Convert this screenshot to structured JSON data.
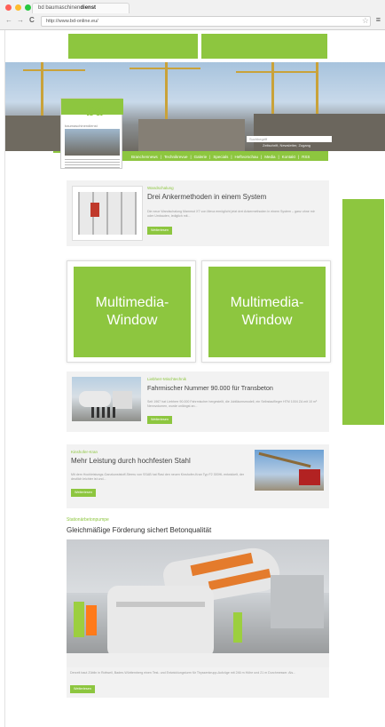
{
  "browser": {
    "tab_title_plain": "bd baumaschinen",
    "tab_title_bold": "dienst",
    "back": "←",
    "forward": "→",
    "reload": "C",
    "url": "http://www.bd-online.eu/",
    "bookmark_icon": "star-icon",
    "menu_icon": "hamburger-icon",
    "dot_colors": [
      "#ff5f57",
      "#febc2e",
      "#28c840"
    ]
  },
  "brand": {
    "accent": "#8dc63f"
  },
  "header": {
    "logo": "bd",
    "logo_sub": "baumaschinendienst",
    "search_placeholder": "Suchbegriff",
    "search_sub": "Zeitschrift, Newsletter, Zugang",
    "nav": [
      "Branchennews",
      "|",
      "Technikrevue",
      "|",
      "Galerie",
      "|",
      "Specials",
      "|",
      "Heftvorschau",
      "|",
      "Media",
      "|",
      "Kontakt",
      "|",
      "RSS"
    ]
  },
  "cards": {
    "card1": {
      "kicker": "Wandschalung",
      "title": "Drei Ankermethoden in einem System",
      "body": "Die neue Wandschalung Mammut XT von Meva ermöglicht jetzt drei Ankermethoden in einem System – ganz ohne mir oder Umbauten, lediglich mit...",
      "button": "Weiterlesen"
    },
    "multimedia": [
      "Multimedia-\nWindow",
      "Multimedia-\nWindow"
    ],
    "card2": {
      "kicker": "Liebherr-Mischtechnik",
      "title": "Fahrmischer Nummer 90.000 für Transbeton",
      "body": "Seit 1967 hat Liebherr 90.000 Fahrmischer hergestellt, die Jubiläumsmodell, ein Selbstauflieger HTM 1004 ZA mit 10 m³ Nennvolumen, wurde unlängst an...",
      "button": "Weiterlesen"
    },
    "card3": {
      "kicker": "Kinshofer-Kran",
      "title": "Mehr Leistung durch hochfesten Stahl",
      "body": "Mit dem Hochleistungs-Ganzkunststoff-Steeru von SSAB hat Rasi den neuen Kinshofer-Kran Typ F2 300HL entwickelt, der deutlich leichter ist und...",
      "button": "Weiterlesen"
    },
    "card4": {
      "kicker": "Stationärbetonpumpe",
      "title": "Gleichmäßige Förderung sichert Betonqualität",
      "body": "Derzeit baut Züblin in Rottweil, Baden-Württemberg einen Test- und Entwicklungsturm für Thyssenkrupp-Aufzüge mit 246 m Höhe und 21 m Durchmesser. Als...",
      "button": "Weiterlesen"
    }
  }
}
